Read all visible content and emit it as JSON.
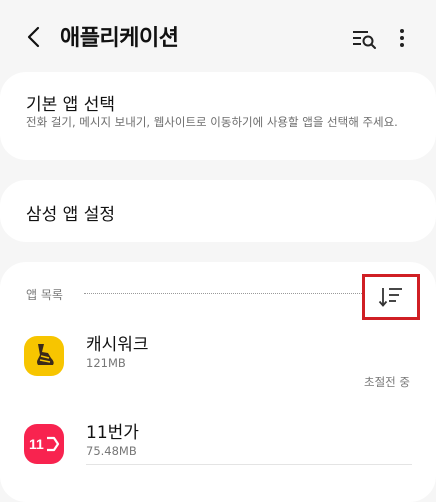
{
  "header": {
    "title": "애플리케이션",
    "back_icon": "chevron-left-icon",
    "search_icon": "list-search-icon",
    "more_icon": "more-vertical-icon"
  },
  "default_apps": {
    "title": "기본 앱 선택",
    "description": "전화 걸기, 메시지 보내기, 웹사이트로 이동하기에 사용할 앱을 선택해 주세요."
  },
  "samsung_settings": {
    "title": "삼성 앱 설정"
  },
  "app_list": {
    "section_label": "앱 목록",
    "sort_icon": "sort-icon",
    "apps": [
      {
        "name": "캐시워크",
        "size": "121MB",
        "status": "초절전 중",
        "icon": "cashwalk-shoe-icon",
        "icon_color": "#f7c500"
      },
      {
        "name": "11번가",
        "size": "75.48MB",
        "status": "",
        "icon": "11st-logo-icon",
        "icon_color": "#f8234f",
        "icon_text": "11"
      }
    ]
  }
}
